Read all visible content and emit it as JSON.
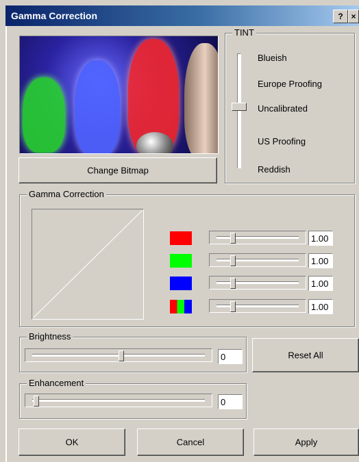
{
  "window": {
    "title": "Gamma Correction",
    "help_label": "?",
    "close_label": "×"
  },
  "preview": {
    "change_bitmap_label": "Change Bitmap"
  },
  "tint": {
    "group_label": "TINT",
    "options": [
      "Blueish",
      "Europe Proofing",
      "Uncalibrated",
      "US Proofing",
      "Reddish"
    ],
    "selected": "Uncalibrated"
  },
  "gamma": {
    "group_label": "Gamma Correction",
    "channels": [
      {
        "name": "red",
        "color": "#ff0000",
        "value": "1.00"
      },
      {
        "name": "green",
        "color": "#00ff00",
        "value": "1.00"
      },
      {
        "name": "blue",
        "color": "#0000ff",
        "value": "1.00"
      },
      {
        "name": "all",
        "color": "rgb",
        "value": "1.00"
      }
    ]
  },
  "brightness": {
    "group_label": "Brightness",
    "value": "0"
  },
  "enhancement": {
    "group_label": "Enhancement",
    "value": "0"
  },
  "buttons": {
    "reset_all": "Reset All",
    "ok": "OK",
    "cancel": "Cancel",
    "apply": "Apply"
  }
}
